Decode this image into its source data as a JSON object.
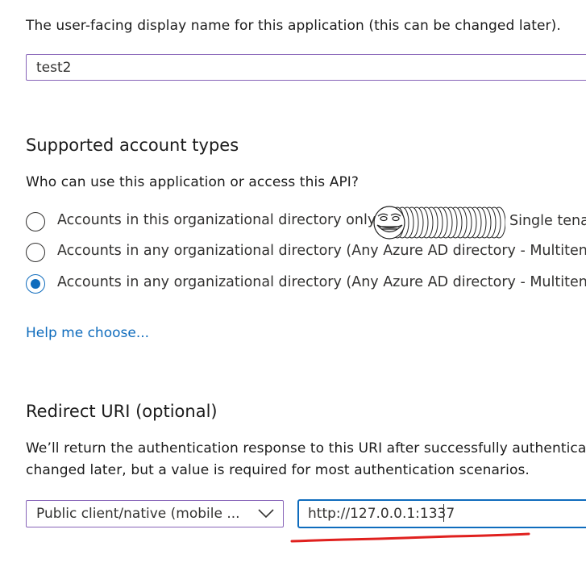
{
  "display_name": {
    "description": "The user-facing display name for this application (this can be changed later).",
    "value": "test2"
  },
  "account_types": {
    "heading": "Supported account types",
    "question": "Who can use this application or access this API?",
    "options": [
      {
        "label_visible": "Accounts in this organizational directory only",
        "label_tail": "Single tena",
        "checked": false
      },
      {
        "label": "Accounts in any organizational directory (Any Azure AD directory - Multitena",
        "checked": false
      },
      {
        "label": "Accounts in any organizational directory (Any Azure AD directory - Multitena",
        "checked": true
      }
    ],
    "help_link": "Help me choose..."
  },
  "redirect_uri": {
    "heading": "Redirect URI (optional)",
    "description_line1": "We’ll return the authentication response to this URI after successfully authenticati",
    "description_line2": "changed later, but a value is required for most authentication scenarios.",
    "platform_select": "Public client/native (mobile ...",
    "uri_value": "http://127.0.0.1:1337"
  },
  "colors": {
    "accent": "#0f6cbd",
    "input_border": "#8764b8",
    "annotation_red": "#e0201e"
  }
}
